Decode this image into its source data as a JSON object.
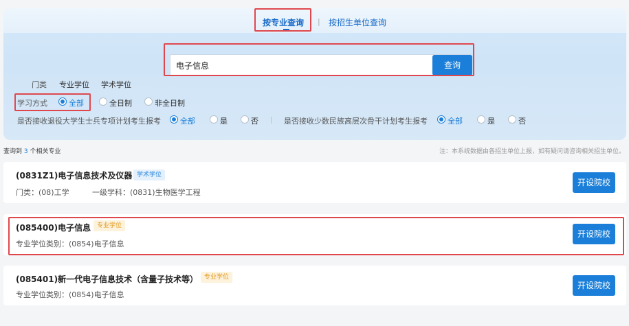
{
  "tabs": {
    "active": "按专业查询",
    "separator": "|",
    "inactive": "按招生单位查询"
  },
  "search": {
    "value": "电子信息",
    "button_label": "查询"
  },
  "filters": {
    "category": {
      "label": "门类",
      "options": [
        "专业学位",
        "学术学位"
      ]
    },
    "study_mode": {
      "label": "学习方式",
      "options": [
        "全部",
        "全日制",
        "非全日制"
      ],
      "selected": "全部"
    },
    "veteran": {
      "label": "是否接收退役大学生士兵专项计划考生报考",
      "options": [
        "全部",
        "是",
        "否"
      ],
      "selected": "全部"
    },
    "separator": "|",
    "minority": {
      "label": "是否接收少数民族高层次骨干计划考生报考",
      "options": [
        "全部",
        "是",
        "否"
      ],
      "selected": "全部"
    }
  },
  "result_summary": {
    "prefix": "查询到",
    "count": "3",
    "suffix": "个相关专业"
  },
  "note": "注：本系统数据由各招生单位上报，如有疑问请咨询相关招生单位。",
  "results": [
    {
      "title": "(0831Z1)电子信息技术及仪器",
      "tag": "学术学位",
      "sub1": "门类：(08)工学",
      "sub2": "一级学科：(0831)生物医学工程",
      "button": "开设院校"
    },
    {
      "title": "(085400)电子信息",
      "tag": "专业学位",
      "sub1": "专业学位类别：(0854)电子信息",
      "button": "开设院校"
    },
    {
      "title": "(085401)新一代电子信息技术（含量子技术等）",
      "tag": "专业学位",
      "sub1": "专业学位类别：(0854)电子信息",
      "button": "开设院校"
    }
  ],
  "colors": {
    "accent": "#1b7fd9",
    "highlight": "#e0474c",
    "tag_academic": "#2d86da",
    "tag_professional": "#e29b23"
  }
}
